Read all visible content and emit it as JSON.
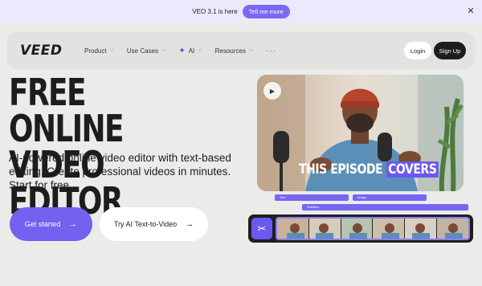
{
  "announcement": {
    "text": "VEO 3.1 is here",
    "button": "Tell me more",
    "close_icon": "close-icon"
  },
  "nav": {
    "logo": "VEED",
    "items": [
      {
        "label": "Product",
        "icon": "chevron-down-icon"
      },
      {
        "label": "Use Cases",
        "icon": "chevron-down-icon"
      },
      {
        "label": "AI",
        "icon": "sparkle-icon"
      },
      {
        "label": "Resources",
        "icon": "chevron-down-icon"
      }
    ],
    "more": "···",
    "login": "Login",
    "signup": "Sign Up"
  },
  "hero": {
    "title_line1": "FREE ONLINE",
    "title_line2": "VIDEO EDITOR",
    "subtitle": "AI-powered online video editor with text-based editing. Create professional videos in minutes. Start for free",
    "cta_primary": "Get started",
    "cta_secondary": "Try AI Text-to-Video"
  },
  "preview": {
    "caption_plain": "THIS EPISODE",
    "caption_highlight": "COVERS",
    "tracks": [
      "Text",
      "Image",
      "Subtitles"
    ]
  },
  "colors": {
    "accent": "#7361f0",
    "dark": "#1d1d1d",
    "background": "#ebebea"
  }
}
